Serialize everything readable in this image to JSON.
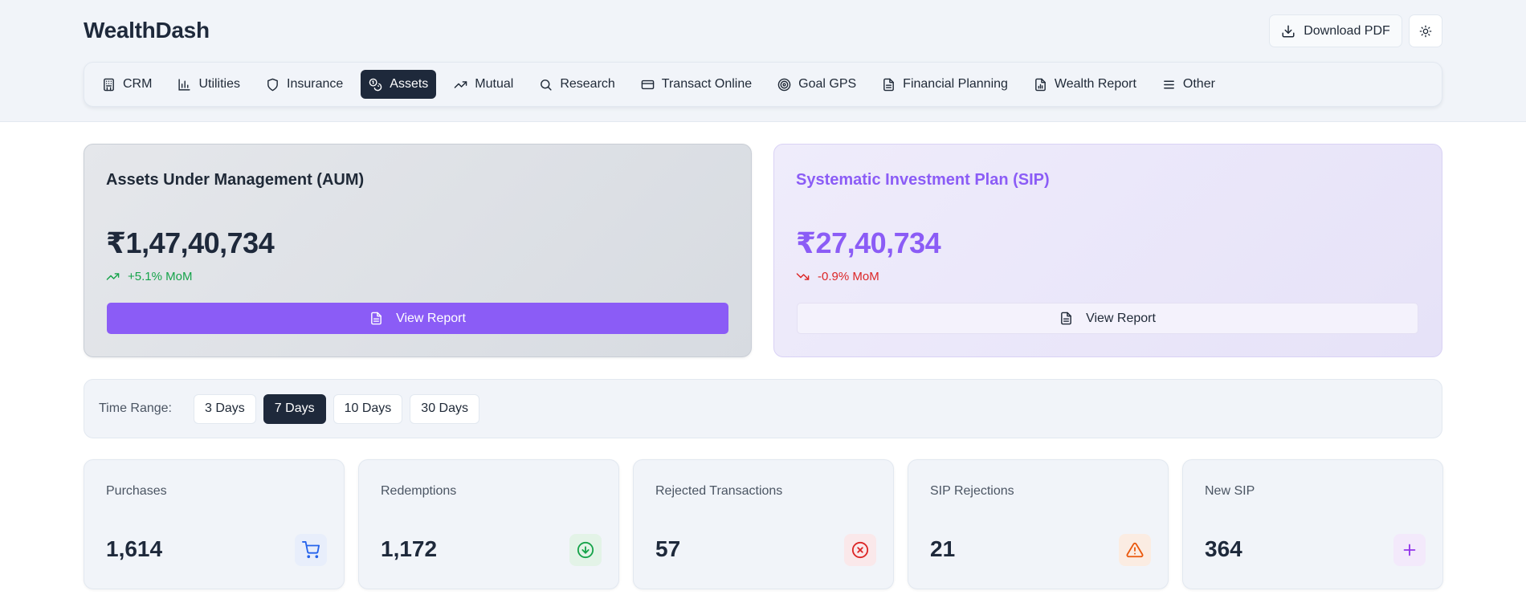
{
  "brand": "WealthDash",
  "header": {
    "download_label": "Download PDF",
    "download_icon": "download-icon",
    "theme_icon": "sun-icon"
  },
  "nav": {
    "active": "Assets",
    "items": [
      {
        "label": "CRM",
        "icon": "building-icon"
      },
      {
        "label": "Utilities",
        "icon": "bar-chart-icon"
      },
      {
        "label": "Insurance",
        "icon": "shield-icon"
      },
      {
        "label": "Assets",
        "icon": "coins-icon"
      },
      {
        "label": "Mutual",
        "icon": "trending-up-icon"
      },
      {
        "label": "Research",
        "icon": "search-icon"
      },
      {
        "label": "Transact Online",
        "icon": "credit-card-icon"
      },
      {
        "label": "Goal GPS",
        "icon": "target-icon"
      },
      {
        "label": "Financial Planning",
        "icon": "file-text-icon"
      },
      {
        "label": "Wealth Report",
        "icon": "file-chart-icon"
      },
      {
        "label": "Other",
        "icon": "menu-icon"
      }
    ]
  },
  "aum": {
    "title": "Assets Under Management (AUM)",
    "value": "₹1,47,40,734",
    "change": "+5.1% MoM",
    "trend": "up",
    "button": "View Report"
  },
  "sip": {
    "title": "Systematic Investment Plan (SIP)",
    "value": "₹27,40,734",
    "change": "-0.9% MoM",
    "trend": "down",
    "button": "View Report"
  },
  "time_range": {
    "label": "Time Range:",
    "options": [
      "3 Days",
      "7 Days",
      "10 Days",
      "30 Days"
    ],
    "selected": "7 Days"
  },
  "stats": [
    {
      "label": "Purchases",
      "value": "1,614",
      "icon": "shopping-cart-icon",
      "color": "#2563eb",
      "bg": "#e8eefb"
    },
    {
      "label": "Redemptions",
      "value": "1,172",
      "icon": "arrow-down-circle-icon",
      "color": "#16a34a",
      "bg": "#e3f3e7"
    },
    {
      "label": "Rejected Transactions",
      "value": "57",
      "icon": "x-circle-icon",
      "color": "#dc2626",
      "bg": "#fae8ea"
    },
    {
      "label": "SIP Rejections",
      "value": "21",
      "icon": "alert-triangle-icon",
      "color": "#ea580c",
      "bg": "#fbece2"
    },
    {
      "label": "New SIP",
      "value": "364",
      "icon": "plus-icon",
      "color": "#9333ea",
      "bg": "#f3e9fb"
    }
  ],
  "colors": {
    "accent": "#8b5cf6",
    "dark": "#1e293b",
    "positive": "#16a34a",
    "negative": "#dc2626"
  }
}
